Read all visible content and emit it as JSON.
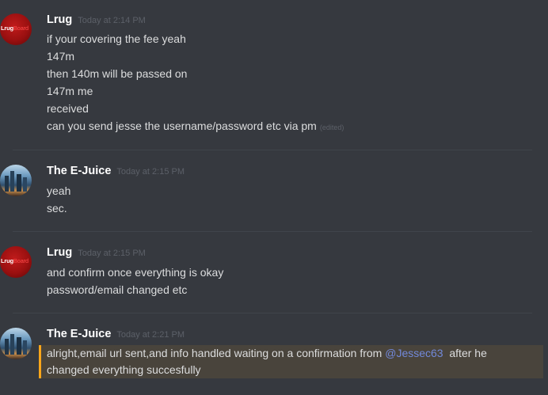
{
  "messages": [
    {
      "author": "Lrug",
      "avatar": "lrug-logo",
      "avatar_text_a": "Lrug",
      "avatar_text_b": "Board",
      "timestamp": "Today at 2:14 PM",
      "lines": [
        "if your covering the fee yeah",
        "147m",
        "then 140m will be passed on",
        "147m me",
        "received",
        "can you send jesse the username/password etc via pm"
      ],
      "edited_label": "(edited)"
    },
    {
      "author": "The E-Juice",
      "avatar": "city-skyline-photo",
      "timestamp": "Today at 2:15 PM",
      "lines": [
        "yeah",
        "sec."
      ]
    },
    {
      "author": "Lrug",
      "avatar": "lrug-logo",
      "avatar_text_a": "Lrug",
      "avatar_text_b": "Board",
      "timestamp": "Today at 2:15 PM",
      "lines": [
        "and confirm once everything is okay",
        "password/email changed etc"
      ]
    },
    {
      "author": "The E-Juice",
      "avatar": "city-skyline-photo",
      "timestamp": "Today at 2:21 PM",
      "highlight_color": "#faa61a",
      "line1_before": "alright,email url sent,and info handled waiting on a confirmation from ",
      "mention": "@Jessec63",
      "line1_after": "  after he",
      "line2": "changed everything succesfully"
    }
  ]
}
